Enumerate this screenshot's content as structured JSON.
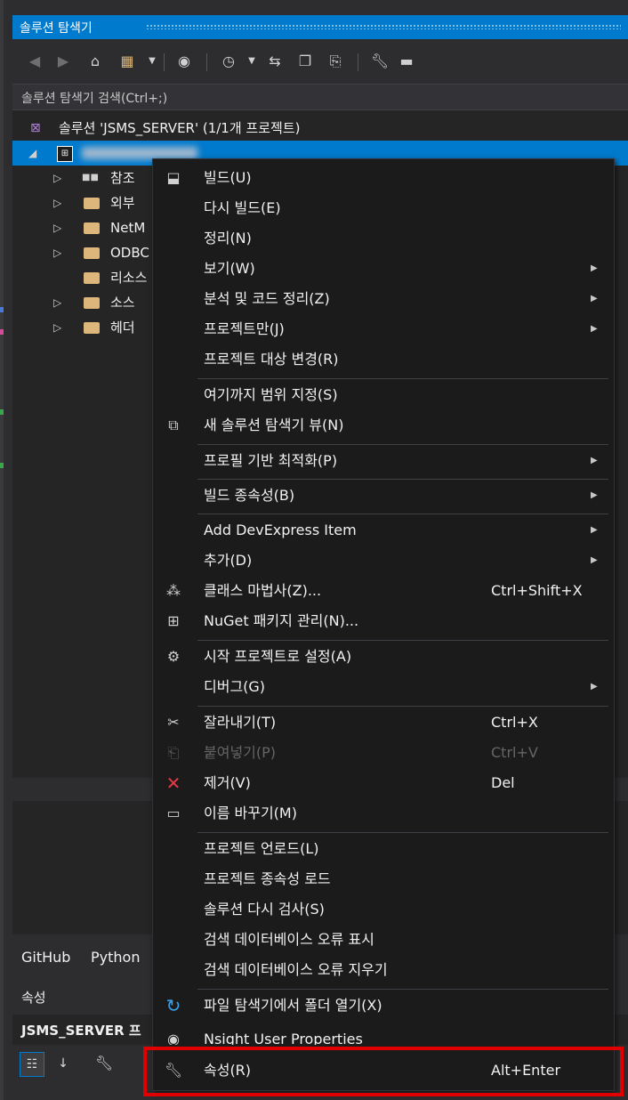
{
  "window": {
    "title": "솔루션 탐색기"
  },
  "search": {
    "placeholder": "솔루션 탐색기 검색(Ctrl+;)"
  },
  "tree": {
    "solution_label": "솔루션 'JSMS_SERVER' (1/1개 프로젝트)",
    "children": [
      {
        "label": "참조"
      },
      {
        "label": "외부"
      },
      {
        "label": "NetM"
      },
      {
        "label": "ODBC"
      },
      {
        "label": "리소스"
      },
      {
        "label": "소스"
      },
      {
        "label": "헤더"
      }
    ]
  },
  "bottom": {
    "tabs": [
      "GitHub",
      "Python"
    ],
    "properties_title": "속성",
    "properties_target": "JSMS_SERVER 프"
  },
  "menu": {
    "items": [
      {
        "label": "빌드(U)",
        "icon": "build-icon"
      },
      {
        "label": "다시 빌드(E)"
      },
      {
        "label": "정리(N)"
      },
      {
        "label": "보기(W)",
        "submenu": true
      },
      {
        "label": "분석 및 코드 정리(Z)",
        "submenu": true
      },
      {
        "label": "프로젝트만(J)",
        "submenu": true
      },
      {
        "label": "프로젝트 대상 변경(R)"
      },
      {
        "label": "여기까지 범위 지정(S)"
      },
      {
        "label": "새 솔루션 탐색기 뷰(N)",
        "icon": "new-view-icon"
      },
      {
        "label": "프로필 기반 최적화(P)",
        "submenu": true
      },
      {
        "label": "빌드 종속성(B)",
        "submenu": true
      },
      {
        "label": "Add DevExpress Item",
        "submenu": true
      },
      {
        "label": "추가(D)",
        "submenu": true
      },
      {
        "label": "클래스 마법사(Z)...",
        "shortcut": "Ctrl+Shift+X",
        "icon": "class-wizard-icon"
      },
      {
        "label": "NuGet 패키지 관리(N)...",
        "icon": "nuget-icon"
      },
      {
        "label": "시작 프로젝트로 설정(A)",
        "icon": "gear-icon"
      },
      {
        "label": "디버그(G)",
        "submenu": true
      },
      {
        "label": "잘라내기(T)",
        "shortcut": "Ctrl+X",
        "icon": "cut-icon"
      },
      {
        "label": "붙여넣기(P)",
        "shortcut": "Ctrl+V",
        "icon": "paste-icon",
        "disabled": true
      },
      {
        "label": "제거(V)",
        "shortcut": "Del",
        "icon": "delete-icon"
      },
      {
        "label": "이름 바꾸기(M)",
        "icon": "rename-icon"
      },
      {
        "label": "프로젝트 언로드(L)"
      },
      {
        "label": "프로젝트 종속성 로드"
      },
      {
        "label": "솔루션 다시 검사(S)"
      },
      {
        "label": "검색 데이터베이스 오류 표시"
      },
      {
        "label": "검색 데이터베이스 오류 지우기"
      },
      {
        "label": "파일 탐색기에서 폴더 열기(X)",
        "icon": "open-folder-icon"
      },
      {
        "label": "Nsight User Properties",
        "icon": "globe-icon"
      },
      {
        "label": "속성(R)",
        "shortcut": "Alt+Enter",
        "icon": "wrench-icon"
      }
    ]
  },
  "colors": {
    "accent": "#007acc",
    "highlight": "#e00000",
    "delete": "#e63946"
  }
}
